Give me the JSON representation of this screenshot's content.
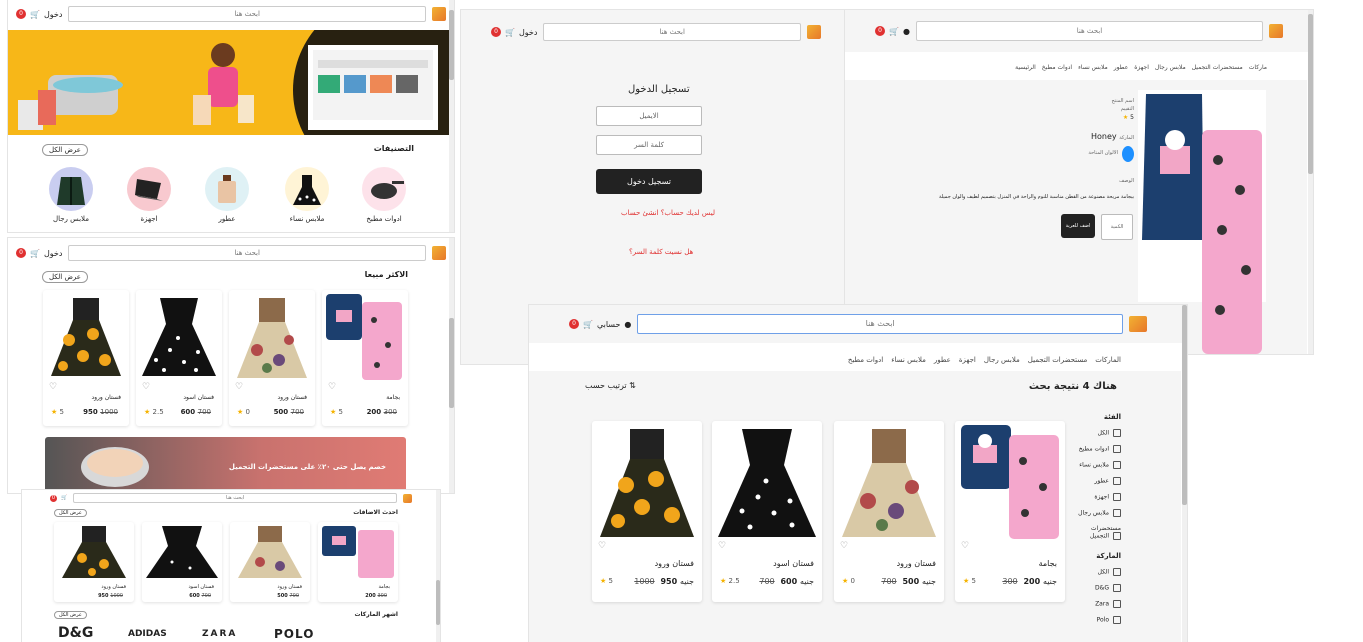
{
  "colors": {
    "accent": "#e03131",
    "banner_yellow": "#f7b718",
    "dark": "#222222",
    "star": "#f5b301"
  },
  "header": {
    "search_placeholder": "ابحث هنا",
    "cart_count": "0",
    "account": "حسابي",
    "login": "دخول"
  },
  "home": {
    "categories_title": "التصنيفات",
    "view_all": "عرض الكل",
    "categories": [
      {
        "label": "ادوات مطبخ",
        "icon": "pan-icon"
      },
      {
        "label": "ملابس نساء",
        "icon": "dress-icon"
      },
      {
        "label": "عطور",
        "icon": "perfume-icon"
      },
      {
        "label": "اجهزة",
        "icon": "laptop-icon"
      },
      {
        "label": "ملابس رجال",
        "icon": "jacket-icon"
      }
    ]
  },
  "bestsellers": {
    "title": "الاكثر مبيعا",
    "view_all": "عرض الكل",
    "products": [
      {
        "name": "بجامة",
        "price": "200",
        "old": "300",
        "rating": "5",
        "currency": "جنيه"
      },
      {
        "name": "فستان ورود",
        "price": "500",
        "old": "700",
        "rating": "0",
        "currency": "جنيه"
      },
      {
        "name": "فستان اسود",
        "price": "600",
        "old": "700",
        "rating": "2.5",
        "currency": "جنيه"
      },
      {
        "name": "فستان ورود",
        "price": "950",
        "old": "1000",
        "rating": "5",
        "currency": "جنيه"
      }
    ],
    "promo": "خصم يصل حتى ٢٠٪ على مستحضرات التجميل"
  },
  "panel3": {
    "section1": "احدث الاضافات",
    "section2": "اشهر الماركات",
    "brands": [
      "POLO",
      "ZARA",
      "ADIDAS",
      "D&G"
    ]
  },
  "login": {
    "title": "تسجيل الدخول",
    "email": "الايميل",
    "password": "كلمة السر",
    "submit": "تسجيل دخول",
    "no_account": "ليس لديك حساب؟ انشئ حساب",
    "forgot": "هل نسيت كلمة السر؟"
  },
  "product": {
    "navlinks": [
      "الرئيسية",
      "ادوات مطبخ",
      "ملابس نساء",
      "عطور",
      "اجهزة",
      "ملابس رجال",
      "مستحضرات التجميل",
      "ماركات"
    ],
    "name_label": "اسم المنتج",
    "rating_label": "التقييم",
    "rating": "5",
    "brand_label": "الماركة",
    "brand": "Honey",
    "color_label": "الالوان المتاحة",
    "desc_label": "الوصف",
    "desc": "بيجامة مريحة مصنوعة من القطن مناسبة للنوم والراحة في المنزل بتصميم لطيف والوان جميلة",
    "add_to_cart": "اضف للعربة",
    "qty": "الكمية"
  },
  "search": {
    "navlinks": [
      "ادوات مطبخ",
      "ملابس نساء",
      "عطور",
      "اجهزة",
      "ملابس رجال",
      "مستحضرات التجميل",
      "الماركات"
    ],
    "results_title": "هناك 4 نتيجة بحث",
    "sort": "ترتيب حسب",
    "category_title": "الفئة",
    "category_options": [
      "الكل",
      "ادوات مطبخ",
      "ملابس نساء",
      "عطور",
      "اجهزة",
      "ملابس رجال",
      "مستحضرات التجميل"
    ],
    "brand_title": "الماركة",
    "brand_options": [
      "الكل",
      "D&G",
      "Zara",
      "Polo"
    ],
    "products": [
      {
        "name": "بجامة",
        "price": "200",
        "old": "300",
        "rating": "5",
        "currency": "جنيه"
      },
      {
        "name": "فستان ورود",
        "price": "500",
        "old": "700",
        "rating": "0",
        "currency": "جنيه"
      },
      {
        "name": "فستان اسود",
        "price": "600",
        "old": "700",
        "rating": "2.5",
        "currency": "جنيه"
      },
      {
        "name": "فستان ورود",
        "price": "950",
        "old": "1000",
        "rating": "5",
        "currency": "جنيه"
      }
    ]
  }
}
